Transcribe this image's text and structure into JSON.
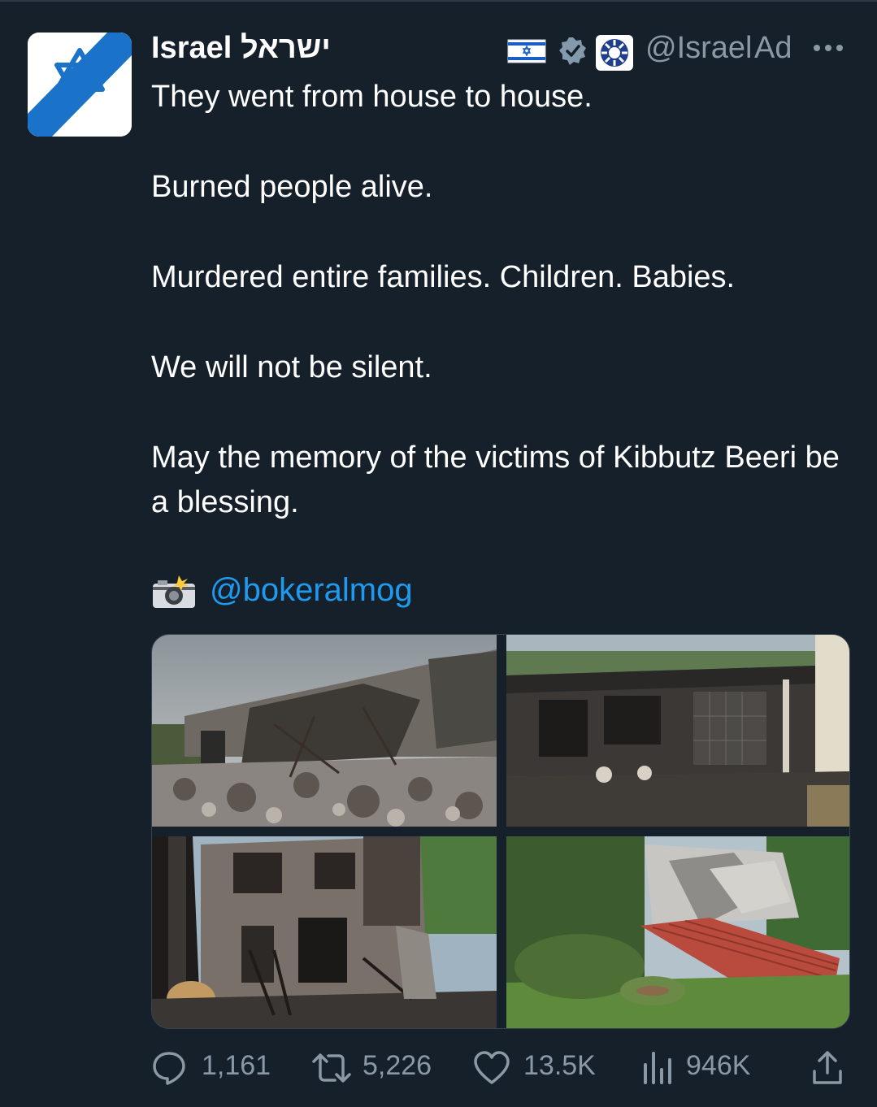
{
  "author": {
    "name": "Israel",
    "name_hebrew": "ישראל",
    "handle": "@Israel",
    "ad_label": "Ad",
    "avatar_icon": "star-of-david-icon",
    "flag_icon": "israel-flag-icon",
    "verified_icon": "verified-badge-icon",
    "affiliation_icon": "government-emblem-icon",
    "more_icon": "more-options-icon"
  },
  "tweet": {
    "paragraphs": [
      "They went from house to house.",
      "Burned people alive.",
      "Murdered entire families. Children. Babies.",
      "We will not be silent.",
      "May the memory of the victims of Kibbutz Beeri be a blessing."
    ],
    "credit_icon": "camera-flash-icon",
    "credit_mention": "@bokeralmog"
  },
  "media": {
    "photos": [
      {
        "name": "photo-destroyed-house-rubble",
        "icon": "photo"
      },
      {
        "name": "photo-burned-house-front",
        "icon": "photo"
      },
      {
        "name": "photo-burned-two-story-house",
        "icon": "photo"
      },
      {
        "name": "photo-collapsed-roof-garden",
        "icon": "photo"
      }
    ]
  },
  "actions": {
    "replies": "1,161",
    "retweets": "5,226",
    "likes": "13.5K",
    "views": "946K",
    "reply_icon": "reply-icon",
    "retweet_icon": "retweet-icon",
    "like_icon": "heart-icon",
    "views_icon": "views-chart-icon",
    "share_icon": "share-icon"
  },
  "colors": {
    "background": "#15202b",
    "text": "#ffffff",
    "muted": "#8b98a5",
    "link": "#1d9bf0",
    "israel_blue": "#1a73c8"
  }
}
